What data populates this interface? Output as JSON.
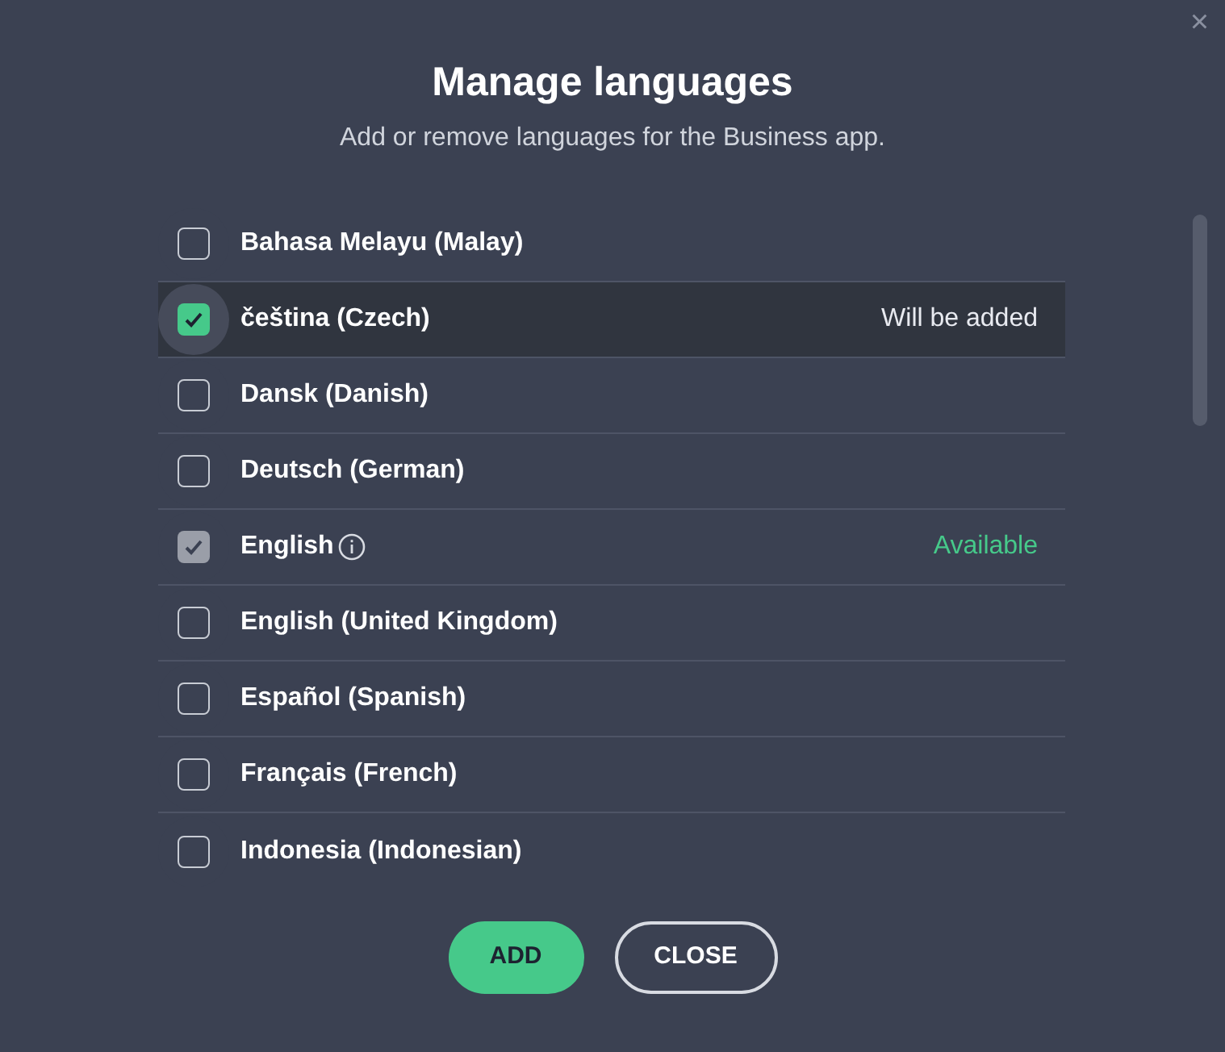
{
  "dialog": {
    "title": "Manage languages",
    "subtitle": "Add or remove languages for the Business app.",
    "close_icon": "×"
  },
  "languages": [
    {
      "name": "Bahasa Melayu (Malay)",
      "checked": false,
      "disabled": false,
      "selected": false
    },
    {
      "name": "čeština (Czech)",
      "checked": true,
      "disabled": false,
      "selected": true,
      "status": {
        "kind": "pending",
        "text": "Will be added"
      }
    },
    {
      "name": "Dansk (Danish)",
      "checked": false,
      "disabled": false,
      "selected": false
    },
    {
      "name": "Deutsch (German)",
      "checked": false,
      "disabled": false,
      "selected": false
    },
    {
      "name": "English",
      "checked": true,
      "disabled": true,
      "selected": false,
      "info": true,
      "status": {
        "kind": "available",
        "text": "Available"
      }
    },
    {
      "name": "English (United Kingdom)",
      "checked": false,
      "disabled": false,
      "selected": false
    },
    {
      "name": "Español (Spanish)",
      "checked": false,
      "disabled": false,
      "selected": false
    },
    {
      "name": "Français (French)",
      "checked": false,
      "disabled": false,
      "selected": false
    },
    {
      "name": "Indonesia (Indonesian)",
      "checked": false,
      "disabled": false,
      "selected": false
    }
  ],
  "buttons": [
    {
      "kind": "primary",
      "label": "ADD"
    },
    {
      "kind": "secondary",
      "label": "CLOSE"
    }
  ]
}
